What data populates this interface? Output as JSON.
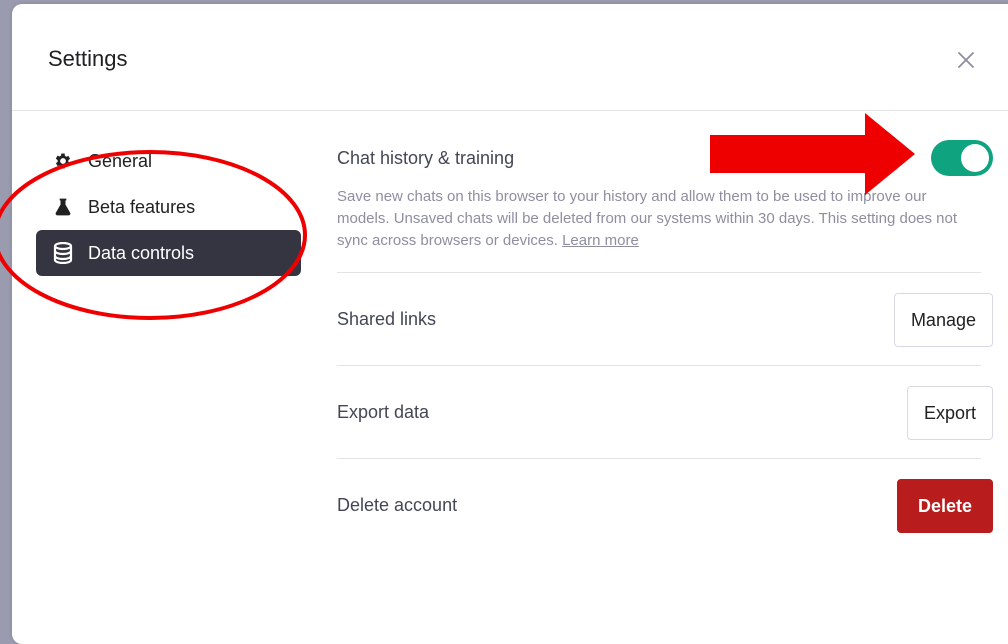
{
  "modal": {
    "title": "Settings",
    "close_icon": "close-icon"
  },
  "sidebar": {
    "items": [
      {
        "label": "General",
        "icon": "gear-icon",
        "active": false
      },
      {
        "label": "Beta features",
        "icon": "flask-icon",
        "active": false
      },
      {
        "label": "Data controls",
        "icon": "database-icon",
        "active": true
      }
    ]
  },
  "content": {
    "chat_history": {
      "title": "Chat history & training",
      "description": "Save new chats on this browser to your history and allow them to be used to improve our models. Unsaved chats will be deleted from our systems within 30 days. This setting does not sync across browsers or devices.",
      "learn_more": "Learn more",
      "toggle_on": true
    },
    "shared_links": {
      "title": "Shared links",
      "button": "Manage"
    },
    "export_data": {
      "title": "Export data",
      "button": "Export"
    },
    "delete_account": {
      "title": "Delete account",
      "button": "Delete"
    }
  },
  "colors": {
    "toggle_on": "#10a37f",
    "active_nav": "#343541",
    "danger": "#b91c1c",
    "annotation": "#ee0000"
  }
}
